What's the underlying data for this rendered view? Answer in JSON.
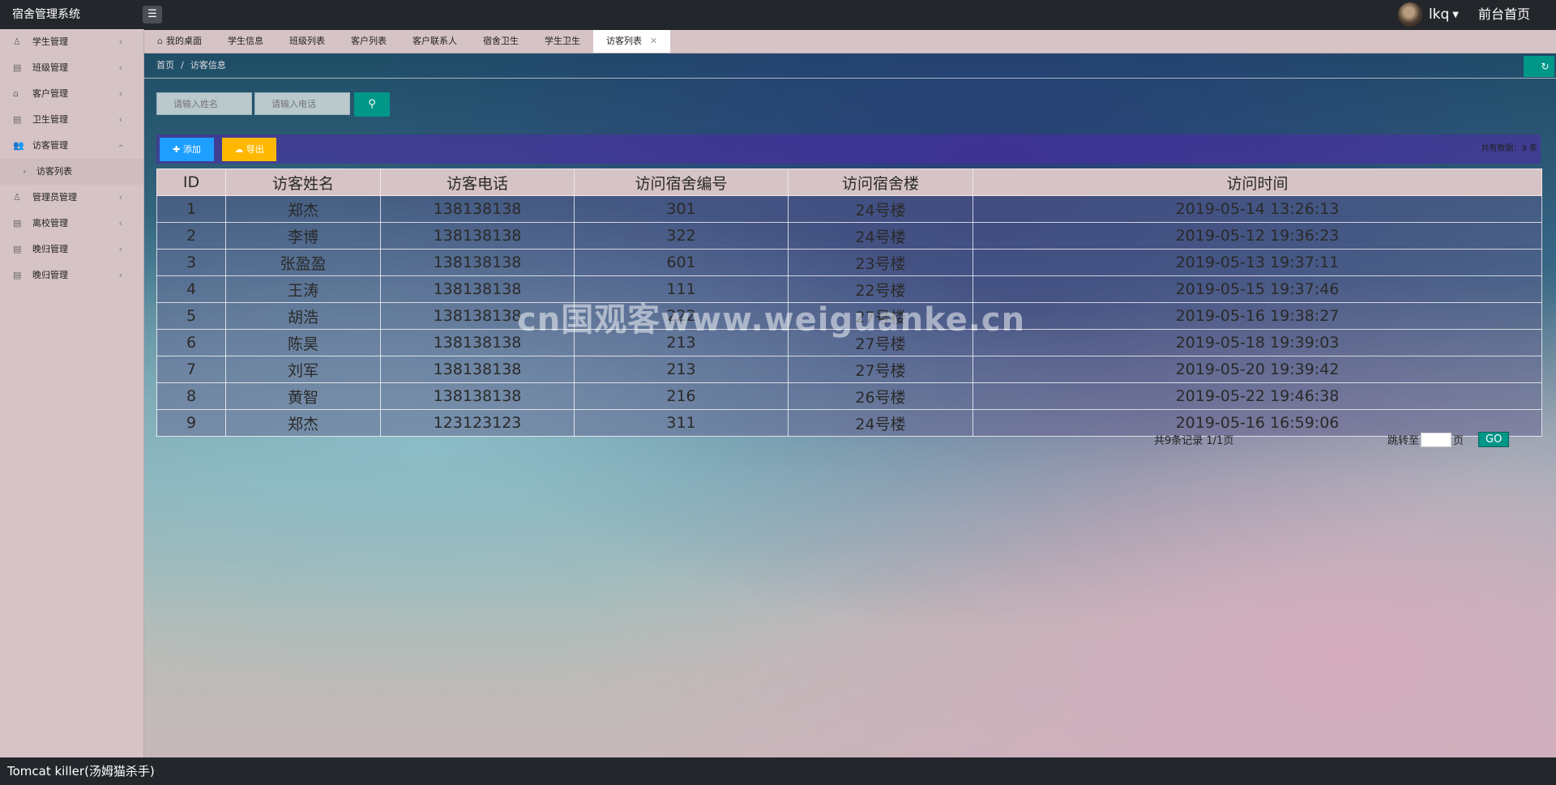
{
  "header": {
    "title": "宿舍管理系统",
    "menu_icon": "☰",
    "username": "lkq",
    "front_link": "前台首页"
  },
  "sidebar": {
    "items": [
      {
        "label": "学生管理",
        "icon": "user-icon"
      },
      {
        "label": "班级管理",
        "icon": "file-icon"
      },
      {
        "label": "客户管理",
        "icon": "inbox-icon"
      },
      {
        "label": "卫生管理",
        "icon": "file-icon"
      },
      {
        "label": "访客管理",
        "icon": "users-icon",
        "expanded": true
      },
      {
        "label": "管理员管理",
        "icon": "user-icon"
      },
      {
        "label": "离校管理",
        "icon": "file-icon"
      },
      {
        "label": "晚归管理",
        "icon": "file-icon"
      },
      {
        "label": "晚归管理",
        "icon": "file-icon"
      }
    ],
    "sub_item": "访客列表"
  },
  "tabs": [
    {
      "label": "我的桌面"
    },
    {
      "label": "学生信息"
    },
    {
      "label": "班级列表"
    },
    {
      "label": "客户列表"
    },
    {
      "label": "客户联系人"
    },
    {
      "label": "宿舍卫生"
    },
    {
      "label": "学生卫生"
    },
    {
      "label": "访客列表",
      "active": true
    }
  ],
  "breadcrumb": {
    "home": "首页",
    "separator": "/",
    "current": "访客信息"
  },
  "search": {
    "name_placeholder": "请输入姓名",
    "phone_placeholder": "请输入电话"
  },
  "toolbar": {
    "add_label": "添加",
    "export_label": "导出",
    "total_text": "共有数据：9 条"
  },
  "table": {
    "columns": [
      "ID",
      "访客姓名",
      "访客电话",
      "访问宿舍编号",
      "访问宿舍楼",
      "访问时间"
    ],
    "rows": [
      [
        "1",
        "郑杰",
        "138138138",
        "301",
        "24号楼",
        "2019-05-14 13:26:13"
      ],
      [
        "2",
        "李博",
        "138138138",
        "322",
        "24号楼",
        "2019-05-12 19:36:23"
      ],
      [
        "3",
        "张盈盈",
        "138138138",
        "601",
        "23号楼",
        "2019-05-13 19:37:11"
      ],
      [
        "4",
        "王涛",
        "138138138",
        "111",
        "22号楼",
        "2019-05-15 19:37:46"
      ],
      [
        "5",
        "胡浩",
        "138138138",
        "222",
        "27号楼",
        "2019-05-16 19:38:27"
      ],
      [
        "6",
        "陈昊",
        "138138138",
        "213",
        "27号楼",
        "2019-05-18 19:39:03"
      ],
      [
        "7",
        "刘军",
        "138138138",
        "213",
        "27号楼",
        "2019-05-20 19:39:42"
      ],
      [
        "8",
        "黄智",
        "138138138",
        "216",
        "26号楼",
        "2019-05-22 19:46:38"
      ],
      [
        "9",
        "郑杰",
        "123123123",
        "311",
        "24号楼",
        "2019-05-16 16:59:06"
      ]
    ]
  },
  "pager": {
    "count_text": "共9条记录  1/1页",
    "jump_prefix": "跳转至",
    "jump_suffix": "页",
    "go_label": "GO"
  },
  "watermark": "cn国观客www.weiguanke.cn",
  "footer": {
    "text": "Tomcat killer(汤姆猫杀手)"
  }
}
